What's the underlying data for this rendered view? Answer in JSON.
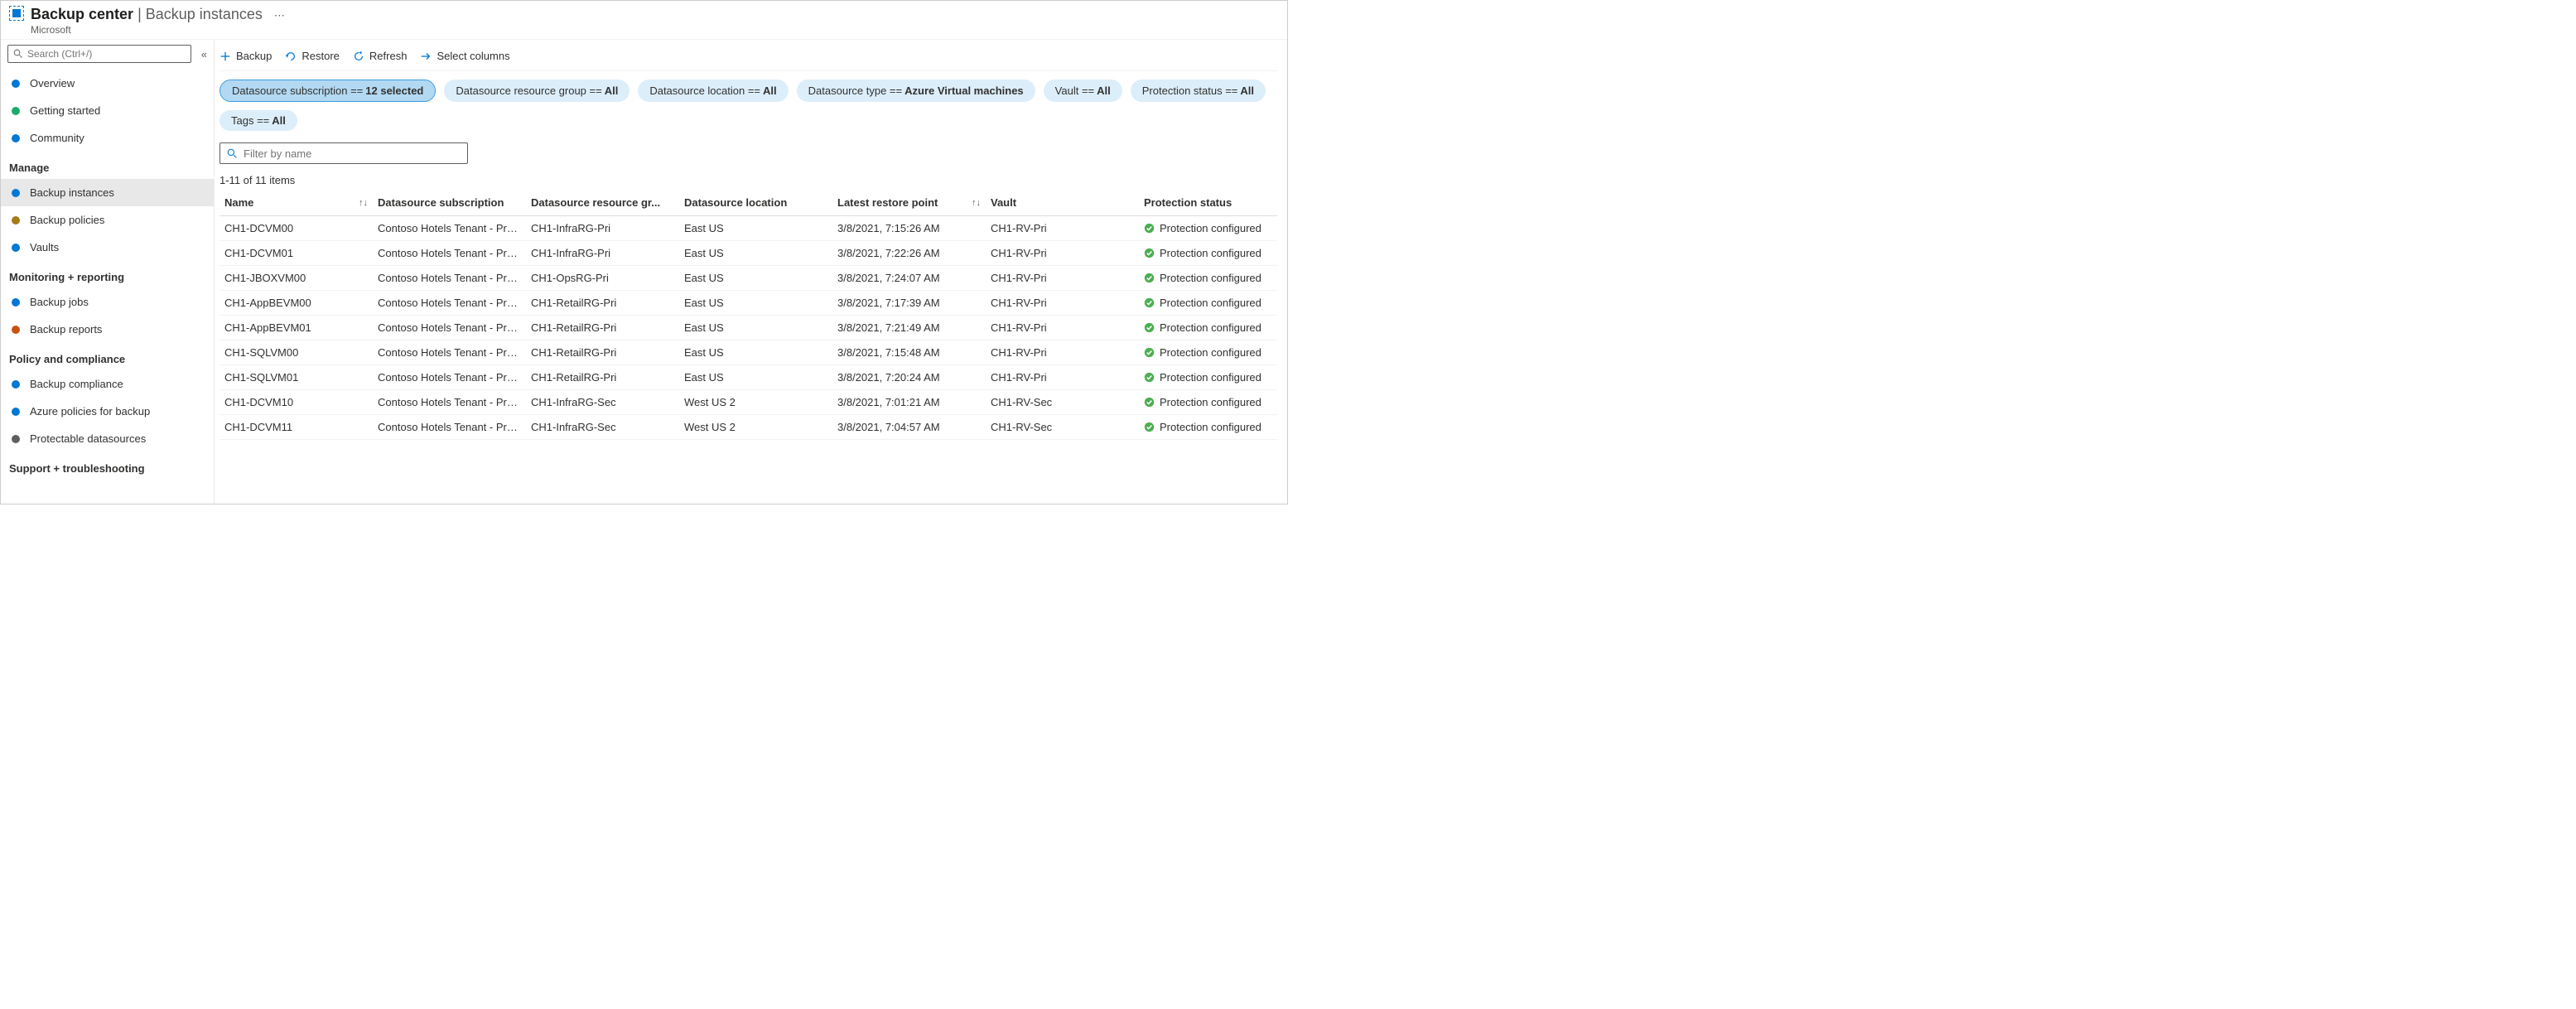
{
  "header": {
    "title_prefix": "Backup center",
    "title_suffix": "Backup instances",
    "subtitle": "Microsoft"
  },
  "sidebar": {
    "search_placeholder": "Search (Ctrl+/)",
    "top": [
      {
        "label": "Overview"
      },
      {
        "label": "Getting started"
      },
      {
        "label": "Community"
      }
    ],
    "sections": [
      {
        "heading": "Manage",
        "items": [
          {
            "label": "Backup instances",
            "selected": true
          },
          {
            "label": "Backup policies"
          },
          {
            "label": "Vaults"
          }
        ]
      },
      {
        "heading": "Monitoring + reporting",
        "items": [
          {
            "label": "Backup jobs"
          },
          {
            "label": "Backup reports"
          }
        ]
      },
      {
        "heading": "Policy and compliance",
        "items": [
          {
            "label": "Backup compliance"
          },
          {
            "label": "Azure policies for backup"
          },
          {
            "label": "Protectable datasources"
          }
        ]
      },
      {
        "heading": "Support + troubleshooting",
        "items": []
      }
    ]
  },
  "toolbar": {
    "backup": "Backup",
    "restore": "Restore",
    "refresh": "Refresh",
    "select_columns": "Select columns"
  },
  "chips": [
    {
      "label": "Datasource subscription == ",
      "value": "12 selected",
      "active": true
    },
    {
      "label": "Datasource resource group == ",
      "value": "All"
    },
    {
      "label": "Datasource location == ",
      "value": "All"
    },
    {
      "label": "Datasource type == ",
      "value": "Azure Virtual machines"
    },
    {
      "label": "Vault == ",
      "value": "All"
    },
    {
      "label": "Protection status == ",
      "value": "All"
    },
    {
      "label": "Tags == ",
      "value": "All"
    }
  ],
  "filter_placeholder": "Filter by name",
  "count_text": "1-11 of 11 items",
  "columns": [
    "Name",
    "Datasource subscription",
    "Datasource resource gr...",
    "Datasource location",
    "Latest restore point",
    "Vault",
    "Protection status"
  ],
  "rows": [
    {
      "name": "CH1-DCVM00",
      "sub": "Contoso Hotels Tenant - Pro...",
      "rg": "CH1-InfraRG-Pri",
      "loc": "East US",
      "restore": "3/8/2021, 7:15:26 AM",
      "vault": "CH1-RV-Pri",
      "status": "Protection configured"
    },
    {
      "name": "CH1-DCVM01",
      "sub": "Contoso Hotels Tenant - Pro...",
      "rg": "CH1-InfraRG-Pri",
      "loc": "East US",
      "restore": "3/8/2021, 7:22:26 AM",
      "vault": "CH1-RV-Pri",
      "status": "Protection configured"
    },
    {
      "name": "CH1-JBOXVM00",
      "sub": "Contoso Hotels Tenant - Pro...",
      "rg": "CH1-OpsRG-Pri",
      "loc": "East US",
      "restore": "3/8/2021, 7:24:07 AM",
      "vault": "CH1-RV-Pri",
      "status": "Protection configured"
    },
    {
      "name": "CH1-AppBEVM00",
      "sub": "Contoso Hotels Tenant - Pro...",
      "rg": "CH1-RetailRG-Pri",
      "loc": "East US",
      "restore": "3/8/2021, 7:17:39 AM",
      "vault": "CH1-RV-Pri",
      "status": "Protection configured"
    },
    {
      "name": "CH1-AppBEVM01",
      "sub": "Contoso Hotels Tenant - Pro...",
      "rg": "CH1-RetailRG-Pri",
      "loc": "East US",
      "restore": "3/8/2021, 7:21:49 AM",
      "vault": "CH1-RV-Pri",
      "status": "Protection configured"
    },
    {
      "name": "CH1-SQLVM00",
      "sub": "Contoso Hotels Tenant - Pro...",
      "rg": "CH1-RetailRG-Pri",
      "loc": "East US",
      "restore": "3/8/2021, 7:15:48 AM",
      "vault": "CH1-RV-Pri",
      "status": "Protection configured"
    },
    {
      "name": "CH1-SQLVM01",
      "sub": "Contoso Hotels Tenant - Pro...",
      "rg": "CH1-RetailRG-Pri",
      "loc": "East US",
      "restore": "3/8/2021, 7:20:24 AM",
      "vault": "CH1-RV-Pri",
      "status": "Protection configured"
    },
    {
      "name": "CH1-DCVM10",
      "sub": "Contoso Hotels Tenant - Pro...",
      "rg": "CH1-InfraRG-Sec",
      "loc": "West US 2",
      "restore": "3/8/2021, 7:01:21 AM",
      "vault": "CH1-RV-Sec",
      "status": "Protection configured"
    },
    {
      "name": "CH1-DCVM11",
      "sub": "Contoso Hotels Tenant - Pro...",
      "rg": "CH1-InfraRG-Sec",
      "loc": "West US 2",
      "restore": "3/8/2021, 7:04:57 AM",
      "vault": "CH1-RV-Sec",
      "status": "Protection configured"
    }
  ]
}
